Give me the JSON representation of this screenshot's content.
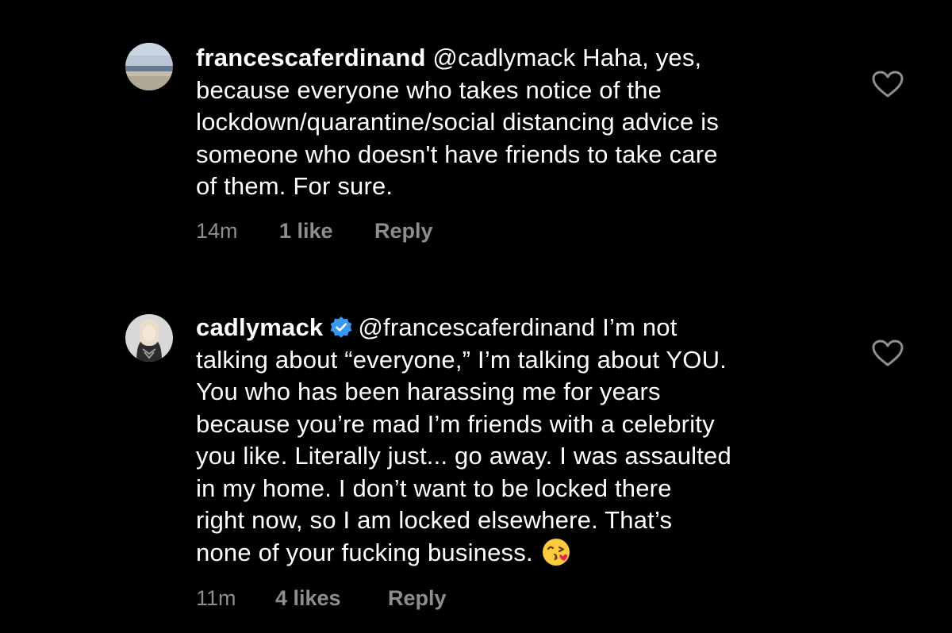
{
  "comments": [
    {
      "username": "francescaferdinand",
      "verified": false,
      "mention": "@cadlymack",
      "lines": [
        "Haha, yes,",
        "because everyone who takes notice of the",
        "lockdown/quarantine/social distancing advice is",
        "someone who doesn't have friends to take  care",
        "of them. For sure."
      ],
      "time": "14m",
      "likes": "1 like",
      "reply": "Reply",
      "avatar_icon": "beach-photo-avatar",
      "like_icon": "heart-outline-icon"
    },
    {
      "username": "cadlymack",
      "verified": true,
      "mention": "@francescaferdinand",
      "lines": [
        "I’m not",
        "talking about “everyone,” I’m talking about YOU.",
        "You who has been harassing me for years",
        "because you’re mad I’m friends with a celebrity",
        "you like. Literally just... go away. I was assaulted",
        "in my home. I don’t want to be locked there",
        "right now, so I am locked elsewhere. That’s",
        "none of your fucking business."
      ],
      "emoji": "face-blowing-a-kiss",
      "time": "11m",
      "likes": "4 likes",
      "reply": "Reply",
      "avatar_icon": "portrait-photo-avatar",
      "like_icon": "heart-outline-icon"
    }
  ],
  "colors": {
    "background": "#000000",
    "text": "#ffffff",
    "meta": "#8e8e8e",
    "verified": "#3897f0"
  }
}
